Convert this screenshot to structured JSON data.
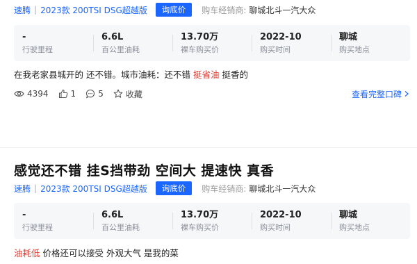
{
  "reviews": [
    {
      "title": "",
      "series": "速腾",
      "model": "2023款 200TSI DSG超越版",
      "price_button": "询底价",
      "dealer_label": "购车经销商:",
      "dealer_name": "聊城北斗一汽大众",
      "stats": [
        {
          "value": "-",
          "label": "行驶里程"
        },
        {
          "value": "6.6L",
          "label": "百公里油耗"
        },
        {
          "value": "13.70万",
          "label": "裸车购买价"
        },
        {
          "value": "2022-10",
          "label": "购买时间"
        },
        {
          "value": "聊城",
          "label": "购买地点"
        }
      ],
      "text_before": "在我老家县城开的 还不错。城市油耗：还不错 ",
      "highlight": "挺省油",
      "text_after": " 挺香的",
      "views": "4394",
      "likes": "1",
      "comments": "5",
      "favorite_label": "收藏",
      "full_review_link": "查看完整口碑"
    },
    {
      "title": "感觉还不错 挂S挡带劲 空间大 提速快 真香",
      "series": "速腾",
      "model": "2023款 200TSI DSG超越版",
      "price_button": "询底价",
      "dealer_label": "购车经销商:",
      "dealer_name": "聊城北斗一汽大众",
      "stats": [
        {
          "value": "-",
          "label": "行驶里程"
        },
        {
          "value": "6.6L",
          "label": "百公里油耗"
        },
        {
          "value": "13.70万",
          "label": "裸车购买价"
        },
        {
          "value": "2022-10",
          "label": "购买时间"
        },
        {
          "value": "聊城",
          "label": "购买地点"
        }
      ],
      "highlight": "油耗低",
      "text_after": " 价格还可以接受 外观大气 是我的菜"
    }
  ],
  "colors": {
    "accent": "#1a66ff",
    "highlight": "#e03a2f",
    "stats_bg": "#f6f7f9"
  }
}
